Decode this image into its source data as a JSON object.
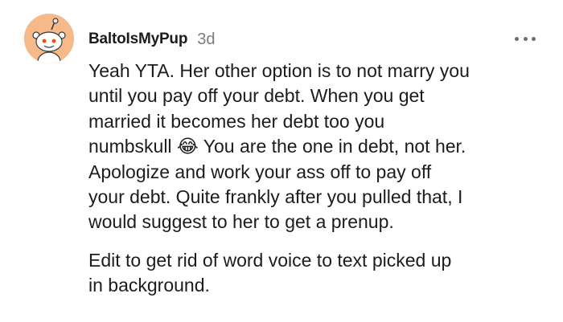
{
  "comment": {
    "avatar_icon": "reddit-snoo-avatar-icon",
    "avatar_color": "#f6b98a",
    "username": "BaltoIsMyPup",
    "timestamp": "3d",
    "more_icon": "more-options-icon",
    "paragraph1": "Yeah YTA. Her other option is to not marry you\nuntil you pay off your debt. When you get\nmarried it becomes her debt too you\nnumbskull 😂 You are the one in debt, not her.\nApologize and work your ass off to pay off\nyour debt. Quite frankly after you pulled that, I\nwould suggest to her to get a prenup.",
    "paragraph2": "Edit to get rid of word voice to text picked up\nin background."
  }
}
